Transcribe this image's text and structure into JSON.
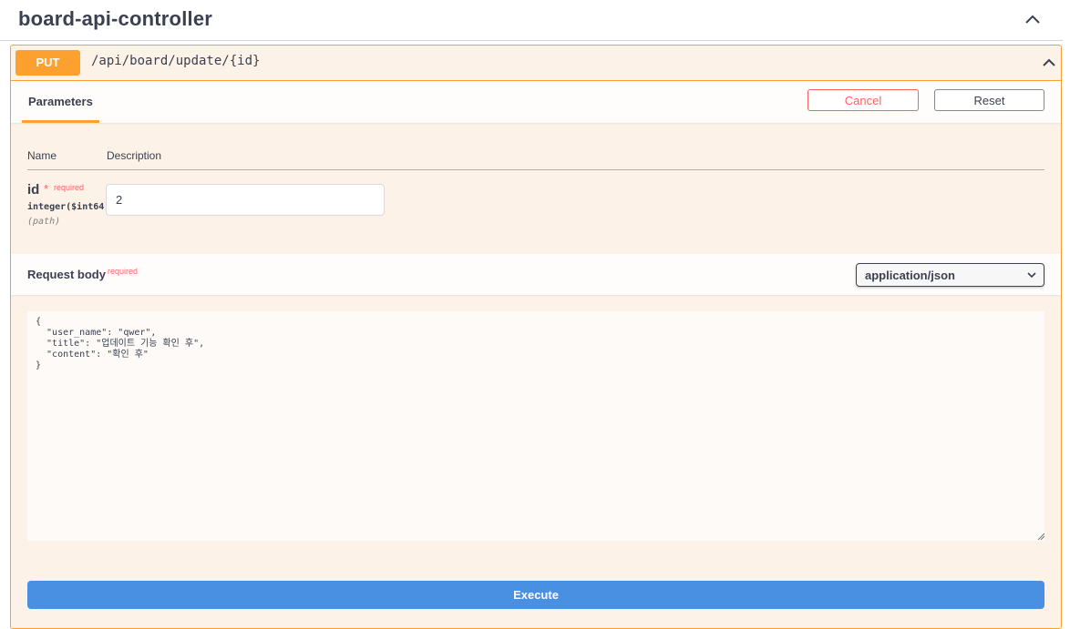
{
  "tag": {
    "title": "board-api-controller",
    "toggle_icon": "chevron-up-icon"
  },
  "operation": {
    "method": "PUT",
    "path": "/api/board/update/{id}",
    "collapse_icon": "chevron-up-icon",
    "method_color": "#fca130"
  },
  "parameters": {
    "tab_label": "Parameters",
    "cancel_label": "Cancel",
    "reset_label": "Reset",
    "col_name": "Name",
    "col_description": "Description",
    "items": [
      {
        "name": "id",
        "required_star": "*",
        "required_label": "required",
        "type": "integer($int64)",
        "in": "(path)",
        "value": "2"
      }
    ]
  },
  "request_body": {
    "title": "Request body",
    "required_label": "required",
    "content_type": "application/json",
    "content": "{\n  \"user_name\": \"qwer\",\n  \"title\": \"업데이트 기능 확인 후\",\n  \"content\": \"확인 후\"\n}"
  },
  "execute_label": "Execute",
  "colors": {
    "accent": "#fca130",
    "danger": "#ff6060",
    "execute": "#4990e2"
  }
}
